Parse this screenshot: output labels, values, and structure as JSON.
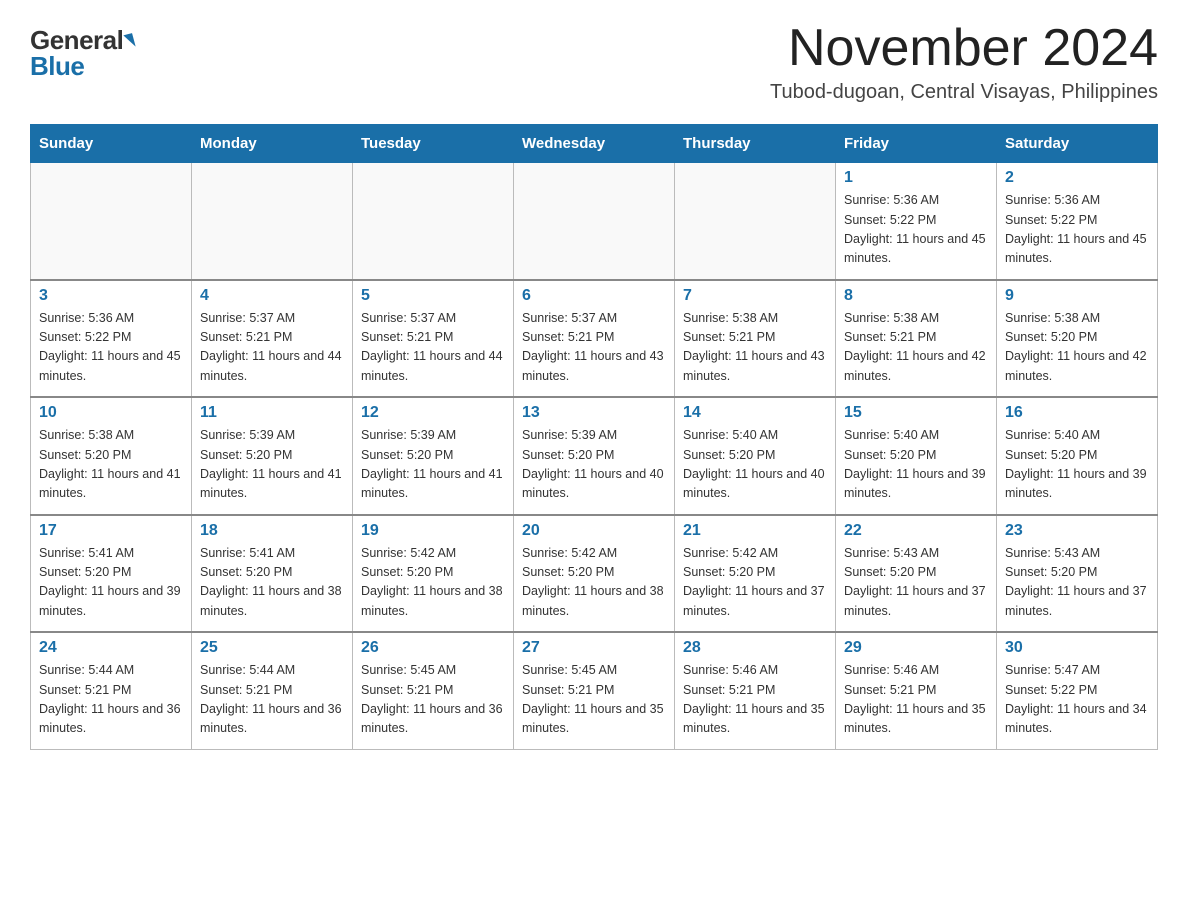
{
  "logo": {
    "general": "General",
    "blue": "Blue"
  },
  "title": {
    "month_year": "November 2024",
    "location": "Tubod-dugoan, Central Visayas, Philippines"
  },
  "days_of_week": [
    "Sunday",
    "Monday",
    "Tuesday",
    "Wednesday",
    "Thursday",
    "Friday",
    "Saturday"
  ],
  "weeks": [
    [
      {
        "day": "",
        "info": ""
      },
      {
        "day": "",
        "info": ""
      },
      {
        "day": "",
        "info": ""
      },
      {
        "day": "",
        "info": ""
      },
      {
        "day": "",
        "info": ""
      },
      {
        "day": "1",
        "info": "Sunrise: 5:36 AM\nSunset: 5:22 PM\nDaylight: 11 hours and 45 minutes."
      },
      {
        "day": "2",
        "info": "Sunrise: 5:36 AM\nSunset: 5:22 PM\nDaylight: 11 hours and 45 minutes."
      }
    ],
    [
      {
        "day": "3",
        "info": "Sunrise: 5:36 AM\nSunset: 5:22 PM\nDaylight: 11 hours and 45 minutes."
      },
      {
        "day": "4",
        "info": "Sunrise: 5:37 AM\nSunset: 5:21 PM\nDaylight: 11 hours and 44 minutes."
      },
      {
        "day": "5",
        "info": "Sunrise: 5:37 AM\nSunset: 5:21 PM\nDaylight: 11 hours and 44 minutes."
      },
      {
        "day": "6",
        "info": "Sunrise: 5:37 AM\nSunset: 5:21 PM\nDaylight: 11 hours and 43 minutes."
      },
      {
        "day": "7",
        "info": "Sunrise: 5:38 AM\nSunset: 5:21 PM\nDaylight: 11 hours and 43 minutes."
      },
      {
        "day": "8",
        "info": "Sunrise: 5:38 AM\nSunset: 5:21 PM\nDaylight: 11 hours and 42 minutes."
      },
      {
        "day": "9",
        "info": "Sunrise: 5:38 AM\nSunset: 5:20 PM\nDaylight: 11 hours and 42 minutes."
      }
    ],
    [
      {
        "day": "10",
        "info": "Sunrise: 5:38 AM\nSunset: 5:20 PM\nDaylight: 11 hours and 41 minutes."
      },
      {
        "day": "11",
        "info": "Sunrise: 5:39 AM\nSunset: 5:20 PM\nDaylight: 11 hours and 41 minutes."
      },
      {
        "day": "12",
        "info": "Sunrise: 5:39 AM\nSunset: 5:20 PM\nDaylight: 11 hours and 41 minutes."
      },
      {
        "day": "13",
        "info": "Sunrise: 5:39 AM\nSunset: 5:20 PM\nDaylight: 11 hours and 40 minutes."
      },
      {
        "day": "14",
        "info": "Sunrise: 5:40 AM\nSunset: 5:20 PM\nDaylight: 11 hours and 40 minutes."
      },
      {
        "day": "15",
        "info": "Sunrise: 5:40 AM\nSunset: 5:20 PM\nDaylight: 11 hours and 39 minutes."
      },
      {
        "day": "16",
        "info": "Sunrise: 5:40 AM\nSunset: 5:20 PM\nDaylight: 11 hours and 39 minutes."
      }
    ],
    [
      {
        "day": "17",
        "info": "Sunrise: 5:41 AM\nSunset: 5:20 PM\nDaylight: 11 hours and 39 minutes."
      },
      {
        "day": "18",
        "info": "Sunrise: 5:41 AM\nSunset: 5:20 PM\nDaylight: 11 hours and 38 minutes."
      },
      {
        "day": "19",
        "info": "Sunrise: 5:42 AM\nSunset: 5:20 PM\nDaylight: 11 hours and 38 minutes."
      },
      {
        "day": "20",
        "info": "Sunrise: 5:42 AM\nSunset: 5:20 PM\nDaylight: 11 hours and 38 minutes."
      },
      {
        "day": "21",
        "info": "Sunrise: 5:42 AM\nSunset: 5:20 PM\nDaylight: 11 hours and 37 minutes."
      },
      {
        "day": "22",
        "info": "Sunrise: 5:43 AM\nSunset: 5:20 PM\nDaylight: 11 hours and 37 minutes."
      },
      {
        "day": "23",
        "info": "Sunrise: 5:43 AM\nSunset: 5:20 PM\nDaylight: 11 hours and 37 minutes."
      }
    ],
    [
      {
        "day": "24",
        "info": "Sunrise: 5:44 AM\nSunset: 5:21 PM\nDaylight: 11 hours and 36 minutes."
      },
      {
        "day": "25",
        "info": "Sunrise: 5:44 AM\nSunset: 5:21 PM\nDaylight: 11 hours and 36 minutes."
      },
      {
        "day": "26",
        "info": "Sunrise: 5:45 AM\nSunset: 5:21 PM\nDaylight: 11 hours and 36 minutes."
      },
      {
        "day": "27",
        "info": "Sunrise: 5:45 AM\nSunset: 5:21 PM\nDaylight: 11 hours and 35 minutes."
      },
      {
        "day": "28",
        "info": "Sunrise: 5:46 AM\nSunset: 5:21 PM\nDaylight: 11 hours and 35 minutes."
      },
      {
        "day": "29",
        "info": "Sunrise: 5:46 AM\nSunset: 5:21 PM\nDaylight: 11 hours and 35 minutes."
      },
      {
        "day": "30",
        "info": "Sunrise: 5:47 AM\nSunset: 5:22 PM\nDaylight: 11 hours and 34 minutes."
      }
    ]
  ]
}
